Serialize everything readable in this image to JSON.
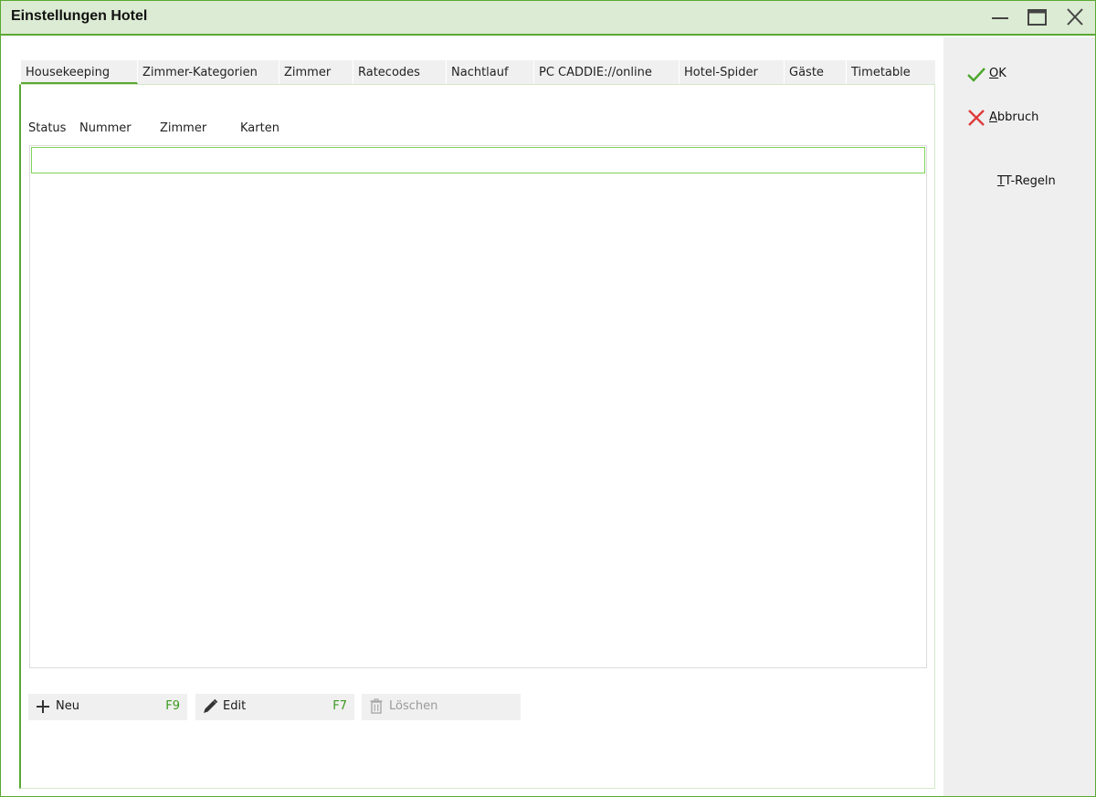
{
  "window": {
    "title": "Einstellungen Hotel"
  },
  "tabs": [
    {
      "label": "Housekeeping",
      "active": true
    },
    {
      "label": "Zimmer-Kategorien"
    },
    {
      "label": "Zimmer"
    },
    {
      "label": "Ratecodes"
    },
    {
      "label": "Nachtlauf"
    },
    {
      "label": "PC CADDIE://online"
    },
    {
      "label": "Hotel-Spider"
    },
    {
      "label": "Gäste"
    },
    {
      "label": "Timetable"
    }
  ],
  "list": {
    "columns": [
      "Status",
      "Nummer",
      "Zimmer",
      "Karten"
    ]
  },
  "buttons": {
    "neu": {
      "label": "Neu",
      "shortcut": "F9"
    },
    "edit": {
      "label": "Edit",
      "shortcut": "F7"
    },
    "loeschen": {
      "label": "Löschen"
    }
  },
  "sidebar": {
    "ok": {
      "mnemonic": "O",
      "rest": "K"
    },
    "abbruch": {
      "mnemonic": "A",
      "rest": "bbruch"
    },
    "tt_regeln": {
      "mnemonic": "T",
      "rest": "T-Regeln"
    }
  },
  "colors": {
    "accent": "#5aa832",
    "titlebar": "#dcebd3",
    "shortcut": "#3a9a1e",
    "cancel": "#e03a3a"
  }
}
